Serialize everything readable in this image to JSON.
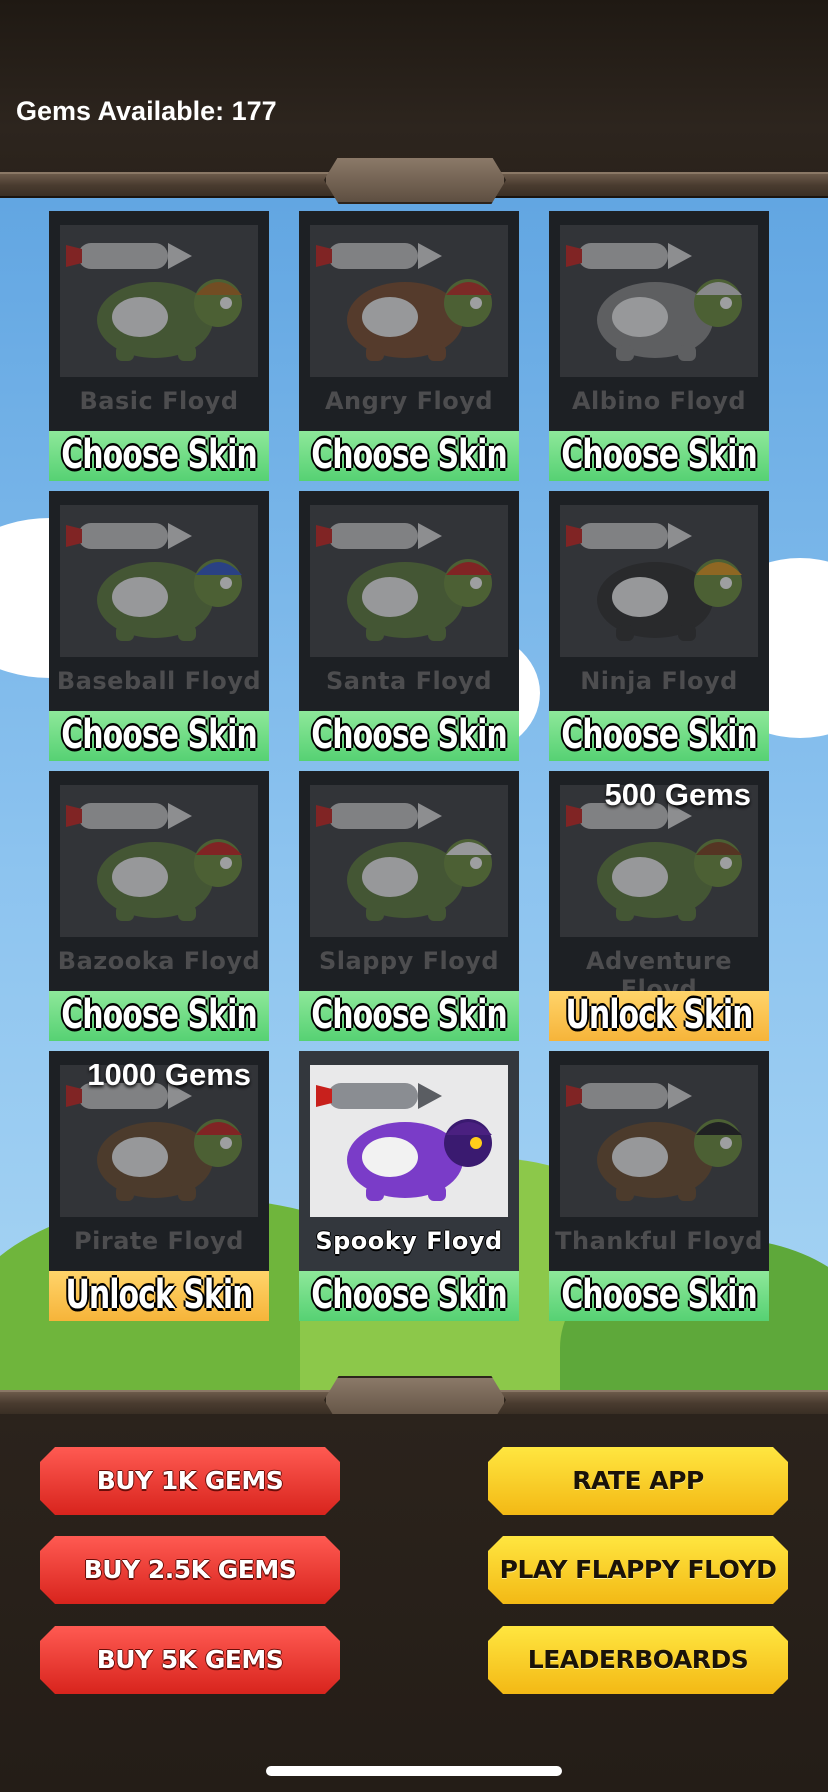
{
  "header": {
    "gems_label": "Gems Available: 177"
  },
  "skins": [
    {
      "name": "Basic Floyd",
      "button": "Choose Skin",
      "state": "choose",
      "shell": "#5c7a3a",
      "helmet": "#b06a1a",
      "icon": "turtle-basic-icon"
    },
    {
      "name": "Angry Floyd",
      "button": "Choose Skin",
      "state": "choose",
      "shell": "#7a4a2a",
      "helmet": "#c02b20",
      "icon": "turtle-angry-icon"
    },
    {
      "name": "Albino Floyd",
      "button": "Choose Skin",
      "state": "choose",
      "shell": "#8a8a8a",
      "helmet": "#d8d8d8",
      "icon": "turtle-albino-icon"
    },
    {
      "name": "Baseball Floyd",
      "button": "Choose Skin",
      "state": "choose",
      "shell": "#5c7a3a",
      "helmet": "#2c54c8",
      "icon": "turtle-baseball-icon"
    },
    {
      "name": "Santa Floyd",
      "button": "Choose Skin",
      "state": "choose",
      "shell": "#5c7a3a",
      "helmet": "#c8201c",
      "icon": "turtle-santa-icon"
    },
    {
      "name": "Ninja Floyd",
      "button": "Choose Skin",
      "state": "choose",
      "shell": "#2a2a2a",
      "helmet": "#e39a1a",
      "icon": "turtle-ninja-icon"
    },
    {
      "name": "Bazooka Floyd",
      "button": "Choose Skin",
      "state": "choose",
      "shell": "#5c7a3a",
      "helmet": "#c8201c",
      "icon": "turtle-bazooka-icon"
    },
    {
      "name": "Slappy Floyd",
      "button": "Choose Skin",
      "state": "choose",
      "shell": "#5c7a3a",
      "helmet": "#f2f2f2",
      "icon": "turtle-slappy-icon"
    },
    {
      "name": "Adventure Floyd",
      "button": "Unlock Skin",
      "state": "unlock",
      "cost": "500 Gems",
      "shell": "#5c7a3a",
      "helmet": "#7a3e1a",
      "icon": "turtle-adventure-icon"
    },
    {
      "name": "Pirate Floyd",
      "button": "Unlock Skin",
      "state": "unlock",
      "cost": "1000 Gems",
      "shell": "#6a4a2a",
      "helmet": "#c8201c",
      "icon": "turtle-pirate-icon"
    },
    {
      "name": "Spooky Floyd",
      "button": "Choose Skin",
      "state": "selected",
      "shell": "#7a3cc8",
      "helmet": "#4a2080",
      "icon": "turtle-spooky-icon"
    },
    {
      "name": "Thankful Floyd",
      "button": "Choose Skin",
      "state": "choose",
      "shell": "#6a4a2a",
      "helmet": "#1a1a1a",
      "icon": "turtle-thankful-icon"
    }
  ],
  "buttons": {
    "buy_1k": "BUY 1K GEMS",
    "buy_2_5k": "BUY 2.5K GEMS",
    "buy_5k": "BUY 5K GEMS",
    "rate": "RATE APP",
    "play": "PLAY FLAPPY FLOYD",
    "leaderboards": "LEADERBOARDS"
  }
}
